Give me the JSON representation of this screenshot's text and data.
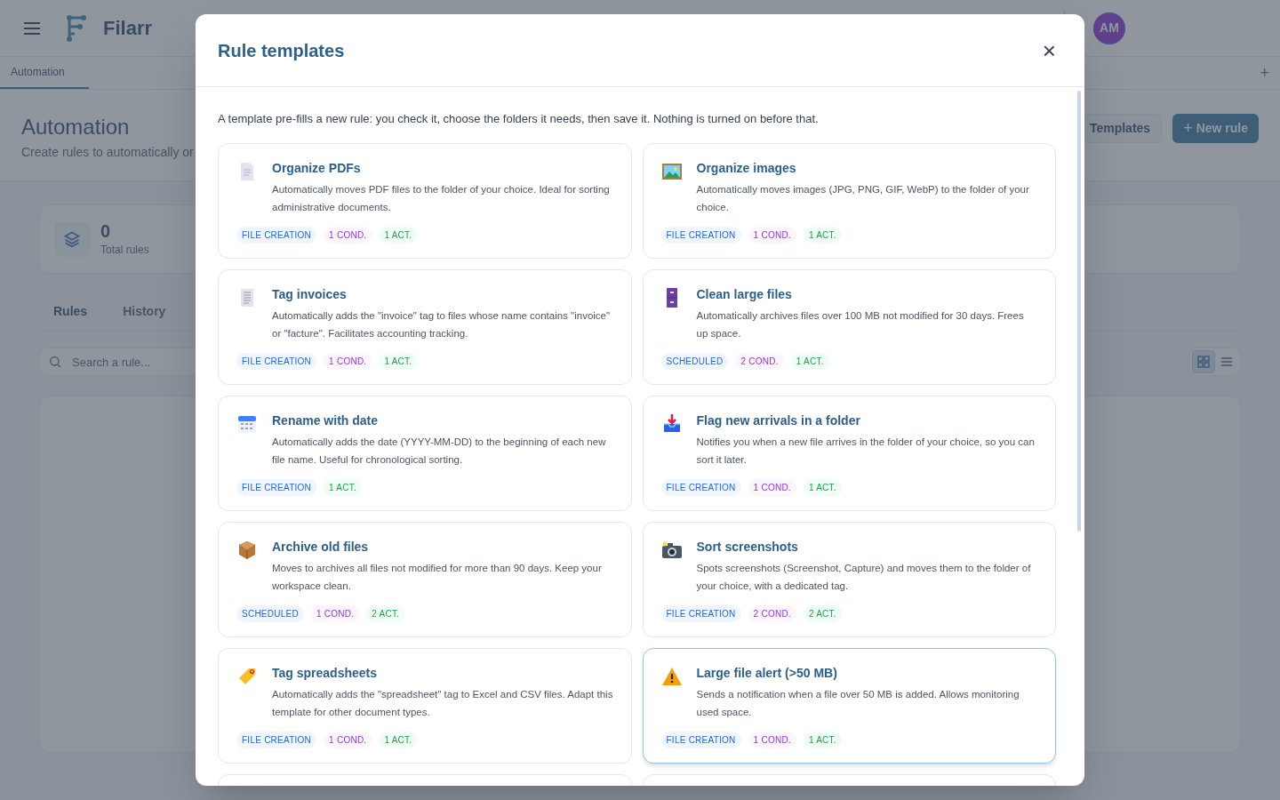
{
  "header": {
    "app_name": "Filarr",
    "avatar": "AM"
  },
  "tabs": [
    {
      "label": "Automation",
      "selected": true
    }
  ],
  "tab_add": "+",
  "page": {
    "title": "Automation",
    "subtitle": "Create rules to automatically or",
    "buttons": [
      {
        "kind": "secondary",
        "label": "Templates"
      },
      {
        "kind": "primary",
        "icon": "+",
        "label": "New rule"
      }
    ]
  },
  "stats": [
    {
      "value": "0",
      "label": "Total rules"
    }
  ],
  "sub_tabs": [
    {
      "label": "Rules",
      "selected": true
    },
    {
      "label": "History",
      "selected": false
    }
  ],
  "search": {
    "placeholder": "Search a rule..."
  },
  "view_toggle": [
    {
      "kind": "grid",
      "selected": true
    },
    {
      "kind": "list",
      "selected": false
    }
  ],
  "modal": {
    "title": "Rule templates",
    "close": "×",
    "intro": "A template pre-fills a new rule: you check it, choose the folders it needs, then save it. Nothing is turned on before that.",
    "templates": [
      {
        "title": "Organize PDFs",
        "description": "Automatically moves PDF files to the folder of your choice. Ideal for sorting administrative documents.",
        "highlighted": false,
        "badges": [
          {
            "kind": "trigger",
            "label": "FILE CREATION"
          },
          {
            "kind": "conditions",
            "label": "1 COND."
          },
          {
            "kind": "actions",
            "label": "1 ACT."
          }
        ]
      },
      {
        "title": "Organize images",
        "description": "Automatically moves images (JPG, PNG, GIF, WebP) to the folder of your choice.",
        "highlighted": false,
        "badges": [
          {
            "kind": "trigger",
            "label": "FILE CREATION"
          },
          {
            "kind": "conditions",
            "label": "1 COND."
          },
          {
            "kind": "actions",
            "label": "1 ACT."
          }
        ]
      },
      {
        "title": "Tag invoices",
        "description": "Automatically adds the \"invoice\" tag to files whose name contains \"invoice\" or \"facture\". Facilitates accounting tracking.",
        "highlighted": false,
        "badges": [
          {
            "kind": "trigger",
            "label": "FILE CREATION"
          },
          {
            "kind": "conditions",
            "label": "1 COND."
          },
          {
            "kind": "actions",
            "label": "1 ACT."
          }
        ]
      },
      {
        "title": "Clean large files",
        "description": "Automatically archives files over 100 MB not modified for 30 days. Frees up space.",
        "highlighted": false,
        "badges": [
          {
            "kind": "trigger",
            "label": "SCHEDULED"
          },
          {
            "kind": "conditions",
            "label": "2 COND."
          },
          {
            "kind": "actions",
            "label": "1 ACT."
          }
        ]
      },
      {
        "title": "Rename with date",
        "description": "Automatically adds the date (YYYY-MM-DD) to the beginning of each new file name. Useful for chronological sorting.",
        "highlighted": false,
        "badges": [
          {
            "kind": "trigger",
            "label": "FILE CREATION"
          },
          {
            "kind": "actions",
            "label": "1 ACT."
          }
        ]
      },
      {
        "title": "Flag new arrivals in a folder",
        "description": "Notifies you when a new file arrives in the folder of your choice, so you can sort it later.",
        "highlighted": false,
        "badges": [
          {
            "kind": "trigger",
            "label": "FILE CREATION"
          },
          {
            "kind": "conditions",
            "label": "1 COND."
          },
          {
            "kind": "actions",
            "label": "1 ACT."
          }
        ]
      },
      {
        "title": "Archive old files",
        "description": "Moves to archives all files not modified for more than 90 days. Keep your workspace clean.",
        "highlighted": false,
        "badges": [
          {
            "kind": "trigger",
            "label": "SCHEDULED"
          },
          {
            "kind": "conditions",
            "label": "1 COND."
          },
          {
            "kind": "actions",
            "label": "2 ACT."
          }
        ]
      },
      {
        "title": "Sort screenshots",
        "description": "Spots screenshots (Screenshot, Capture) and moves them to the folder of your choice, with a dedicated tag.",
        "highlighted": false,
        "badges": [
          {
            "kind": "trigger",
            "label": "FILE CREATION"
          },
          {
            "kind": "conditions",
            "label": "2 COND."
          },
          {
            "kind": "actions",
            "label": "2 ACT."
          }
        ]
      },
      {
        "title": "Tag spreadsheets",
        "description": "Automatically adds the \"spreadsheet\" tag to Excel and CSV files. Adapt this template for other document types.",
        "highlighted": false,
        "badges": [
          {
            "kind": "trigger",
            "label": "FILE CREATION"
          },
          {
            "kind": "conditions",
            "label": "1 COND."
          },
          {
            "kind": "actions",
            "label": "1 ACT."
          }
        ]
      },
      {
        "title": "Large file alert (>50 MB)",
        "description": "Sends a notification when a file over 50 MB is added. Allows monitoring used space.",
        "highlighted": true,
        "badges": [
          {
            "kind": "trigger",
            "label": "FILE CREATION"
          },
          {
            "kind": "conditions",
            "label": "1 COND."
          },
          {
            "kind": "actions",
            "label": "1 ACT."
          }
        ]
      }
    ]
  }
}
